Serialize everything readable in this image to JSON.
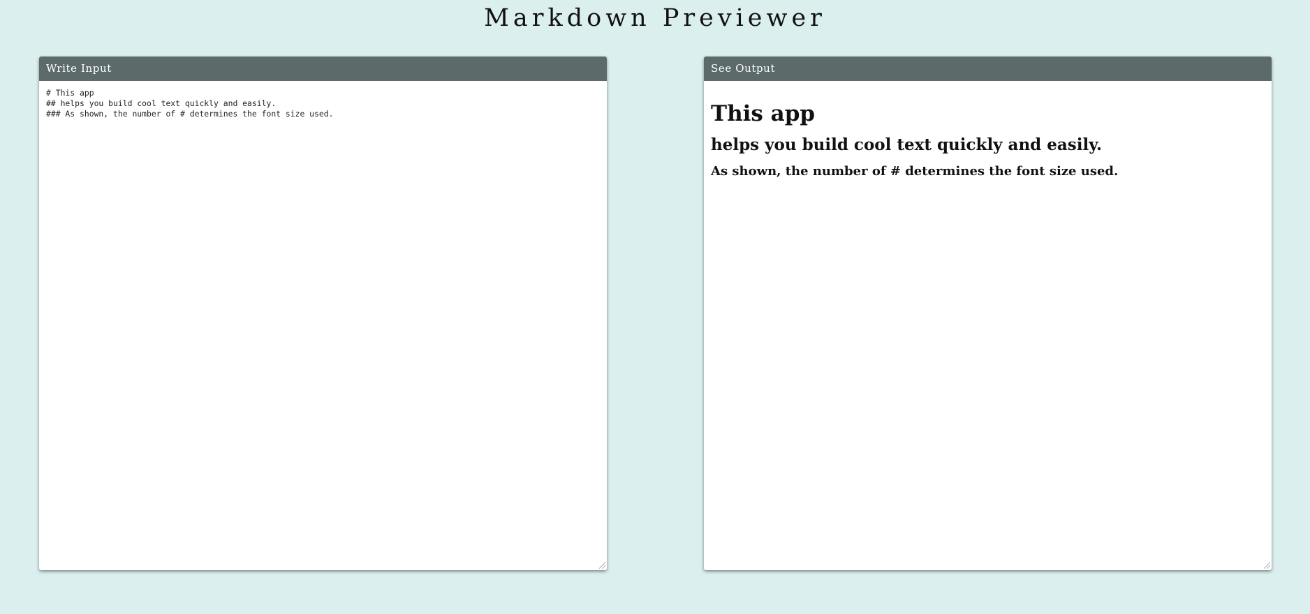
{
  "app": {
    "title": "Markdown Previewer"
  },
  "input_panel": {
    "header": "Write Input",
    "value": "# This app\n## helps you build cool text quickly and easily.\n### As shown, the number of # determines the font size used.\n"
  },
  "output_panel": {
    "header": "See Output",
    "h1": "This app",
    "h2": "helps you build cool text quickly and easily.",
    "h3": "As shown, the number of # determines the font size used."
  },
  "colors": {
    "background": "#dbefee",
    "panel_header": "#5c6b6a",
    "panel_body": "#ffffff"
  }
}
